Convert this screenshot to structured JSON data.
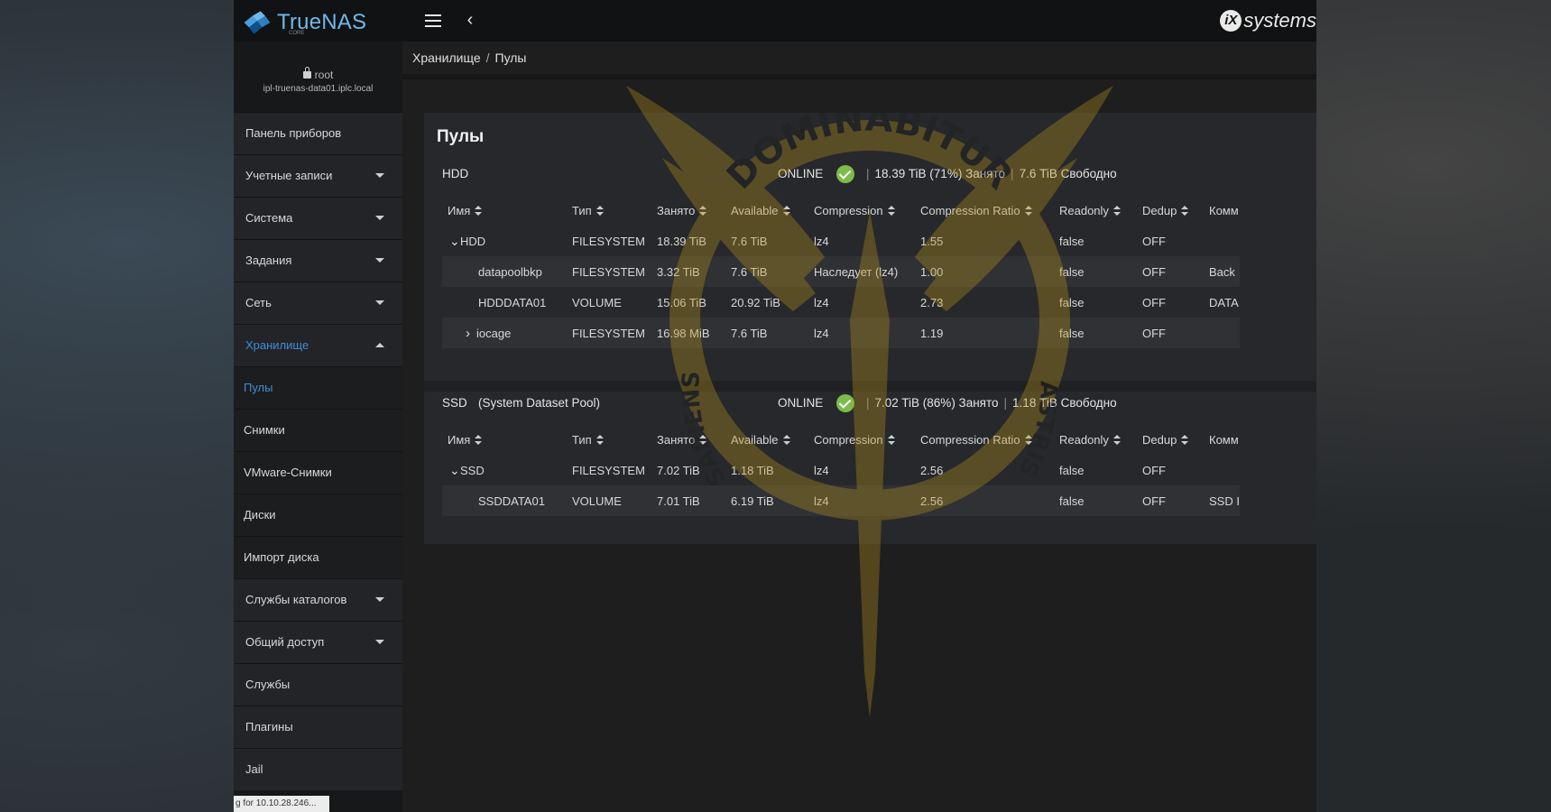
{
  "app": {
    "brand": "TrueNAS",
    "edition": "CORE",
    "vendor": "systems"
  },
  "user": {
    "name": "root",
    "host": "ipl-truenas-data01.iplc.local"
  },
  "sidebar": {
    "items": [
      {
        "label": "Панель приборов",
        "expandable": false
      },
      {
        "label": "Учетные записи",
        "expandable": true
      },
      {
        "label": "Система",
        "expandable": true
      },
      {
        "label": "Задания",
        "expandable": true
      },
      {
        "label": "Сеть",
        "expandable": true
      },
      {
        "label": "Хранилище",
        "expandable": true,
        "expanded": true,
        "active": true
      },
      {
        "label": "Пулы",
        "sub": true,
        "active": true
      },
      {
        "label": "Снимки",
        "sub": true
      },
      {
        "label": "VMware-Снимки",
        "sub": true
      },
      {
        "label": "Диски",
        "sub": true
      },
      {
        "label": "Импорт диска",
        "sub": true
      },
      {
        "label": "Службы каталогов",
        "expandable": true
      },
      {
        "label": "Общий доступ",
        "expandable": true
      },
      {
        "label": "Службы",
        "expandable": false
      },
      {
        "label": "Плагины",
        "expandable": false
      },
      {
        "label": "Jail",
        "expandable": false
      }
    ],
    "status_tip": "g for 10.10.28.246..."
  },
  "breadcrumb": {
    "parent": "Хранилище",
    "current": "Пулы",
    "separator": "/"
  },
  "page": {
    "title": "Пулы"
  },
  "columns": [
    "Имя",
    "Тип",
    "Занято",
    "Available",
    "Compression",
    "Compression Ratio",
    "Readonly",
    "Dedup",
    "Комм"
  ],
  "pools": [
    {
      "name": "HDD",
      "extra": "",
      "status": "ONLINE",
      "used": "18.39 TiB (71%) Занято",
      "free": "7.6 TiB Свободно",
      "rows": [
        {
          "chevron": "v",
          "level": 0,
          "name": "HDD",
          "type": "FILESYSTEM",
          "used": "18.39 TiB",
          "available": "7.6 TiB",
          "compression": "lz4",
          "ratio": "1.55",
          "readonly": "false",
          "dedup": "OFF",
          "comment": ""
        },
        {
          "chevron": "",
          "level": 1,
          "name": "datapoolbkp",
          "type": "FILESYSTEM",
          "used": "3.32 TiB",
          "available": "7.6 TiB",
          "compression": "Наследует (lz4)",
          "ratio": "1.00",
          "readonly": "false",
          "dedup": "OFF",
          "comment": "Back"
        },
        {
          "chevron": "",
          "level": 1,
          "name": "HDDDATA01",
          "type": "VOLUME",
          "used": "15.06 TiB",
          "available": "20.92 TiB",
          "compression": "lz4",
          "ratio": "2.73",
          "readonly": "false",
          "dedup": "OFF",
          "comment": "DATA"
        },
        {
          "chevron": ">",
          "level": 1,
          "name": "iocage",
          "type": "FILESYSTEM",
          "used": "16.98 MiB",
          "available": "7.6 TiB",
          "compression": "lz4",
          "ratio": "1.19",
          "readonly": "false",
          "dedup": "OFF",
          "comment": ""
        }
      ]
    },
    {
      "name": "SSD",
      "extra": "(System Dataset Pool)",
      "status": "ONLINE",
      "used": "7.02 TiB (86%) Занято",
      "free": "1.18 TiB Свободно",
      "rows": [
        {
          "chevron": "v",
          "level": 0,
          "name": "SSD",
          "type": "FILESYSTEM",
          "used": "7.02 TiB",
          "available": "1.18 TiB",
          "compression": "lz4",
          "ratio": "2.56",
          "readonly": "false",
          "dedup": "OFF",
          "comment": ""
        },
        {
          "chevron": "",
          "level": 1,
          "name": "SSDDATA01",
          "type": "VOLUME",
          "used": "7.01 TiB",
          "available": "6.19 TiB",
          "compression": "lz4",
          "ratio": "2.56",
          "readonly": "false",
          "dedup": "OFF",
          "comment": "SSD I"
        }
      ]
    }
  ],
  "watermark": {
    "text_top": "DOMINABITUR",
    "text_left": "SAPIENS",
    "text_right": "ASTRIS"
  },
  "colors": {
    "accent": "#3f8fd8",
    "online": "#7dbb4a",
    "watermark": "#b8921a"
  }
}
